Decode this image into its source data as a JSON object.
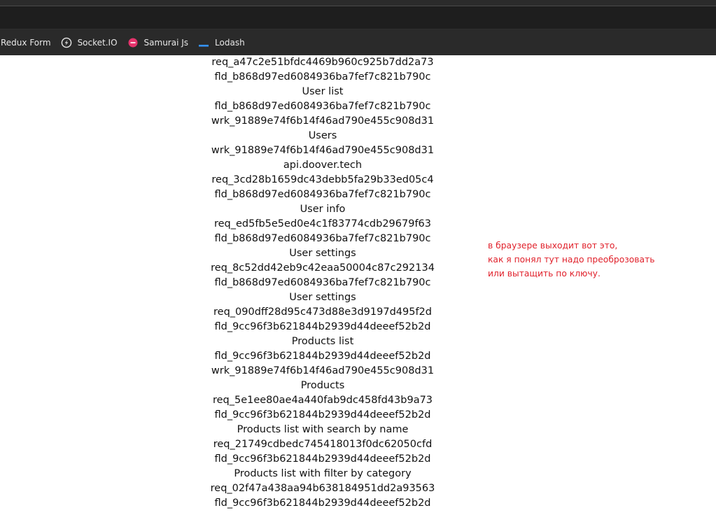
{
  "bookmarks": [
    {
      "label": "Redux Form",
      "icon": "none"
    },
    {
      "label": "Socket.IO",
      "icon": "socketio-icon"
    },
    {
      "label": "Samurai Js",
      "icon": "samurai-icon"
    },
    {
      "label": "Lodash",
      "icon": "lodash-icon"
    }
  ],
  "colors": {
    "samurai": "#e5336c",
    "lodash": "#3492ff",
    "note": "#e0202a"
  },
  "lines": [
    "req_a47c2e51bfdc4469b960c925b7dd2a73",
    "fld_b868d97ed6084936ba7fef7c821b790c",
    "User list",
    "fld_b868d97ed6084936ba7fef7c821b790c",
    "wrk_91889e74f6b14f46ad790e455c908d31",
    "Users",
    "wrk_91889e74f6b14f46ad790e455c908d31",
    "api.doover.tech",
    "req_3cd28b1659dc43debb5fa29b33ed05c4",
    "fld_b868d97ed6084936ba7fef7c821b790c",
    "User info",
    "req_ed5fb5e5ed0e4c1f83774cdb29679f63",
    "fld_b868d97ed6084936ba7fef7c821b790c",
    "User settings",
    "req_8c52dd42eb9c42eaa50004c87c292134",
    "fld_b868d97ed6084936ba7fef7c821b790c",
    "User settings",
    "req_090dff28d95c473d88e3d9197d495f2d",
    "fld_9cc96f3b621844b2939d44deeef52b2d",
    "Products list",
    "fld_9cc96f3b621844b2939d44deeef52b2d",
    "wrk_91889e74f6b14f46ad790e455c908d31",
    "Products",
    "req_5e1ee80ae4a440fab9dc458fd43b9a73",
    "fld_9cc96f3b621844b2939d44deeef52b2d",
    "Products list with search by name",
    "req_21749cdbedc745418013f0dc62050cfd",
    "fld_9cc96f3b621844b2939d44deeef52b2d",
    "Products list with filter by category",
    "req_02f47a438aa94b638184951dd2a93563",
    "fld_9cc96f3b621844b2939d44deeef52b2d"
  ],
  "note": {
    "line1": "в браузере выходит вот это,",
    "line2": "как я понял тут надо преоброзовать",
    "line3": "или вытащить по ключу."
  }
}
